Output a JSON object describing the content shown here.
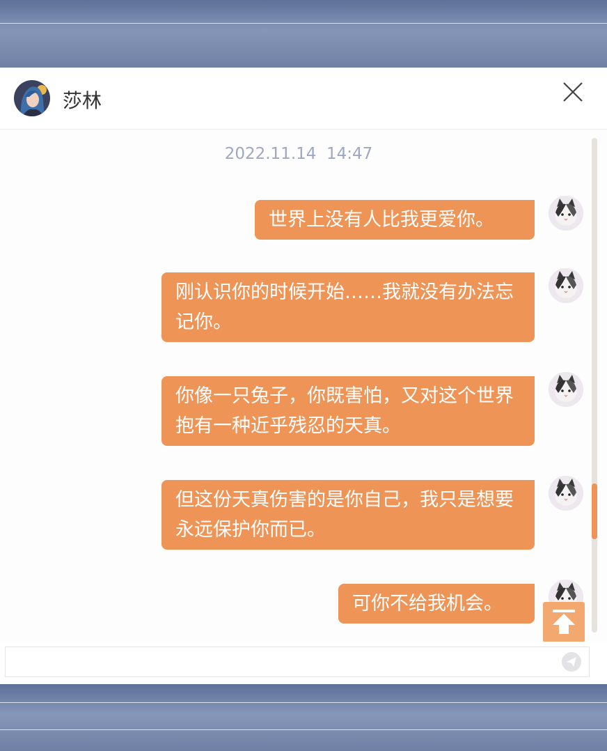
{
  "contact": {
    "name": "莎林",
    "avatar": "avatar-girl-icon"
  },
  "chat": {
    "timestamp": "2022.11.14  14:47",
    "messages": [
      {
        "text": "世界上没有人比我更爱你。",
        "sender_avatar": "cat-avatar-icon"
      },
      {
        "text": "刚认识你的时候开始……我就没有办法忘记你。",
        "sender_avatar": "cat-avatar-icon"
      },
      {
        "text": "你像一只兔子，你既害怕，又对这个世界抱有一种近乎残忍的天真。",
        "sender_avatar": "cat-avatar-icon"
      },
      {
        "text": "但这份天真伤害的是你自己，我只是想要永远保护你而已。",
        "sender_avatar": "cat-avatar-icon"
      },
      {
        "text": "可你不给我机会。",
        "sender_avatar": "cat-avatar-icon"
      }
    ]
  },
  "input": {
    "value": "",
    "placeholder": ""
  },
  "icons": {
    "close": "close-icon",
    "send": "send-icon",
    "back_to_top": "arrow-up-to-top-icon"
  },
  "colors": {
    "bubble": "#ee9456",
    "timestamp": "#9ea6c3",
    "scroll_thumb": "#ee9456",
    "frame": "#6e7fa3"
  }
}
